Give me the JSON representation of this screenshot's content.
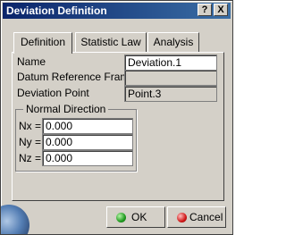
{
  "window": {
    "title": "Deviation Definition",
    "help_label": "?",
    "close_label": "X"
  },
  "tabs": [
    {
      "label": "Definition",
      "active": true
    },
    {
      "label": "Statistic Law",
      "active": false
    },
    {
      "label": "Analysis",
      "active": false
    }
  ],
  "form": {
    "name_label": "Name",
    "name_value": "Deviation.1",
    "datum_label": "Datum Reference Frame",
    "datum_value": "",
    "point_label": "Deviation Point",
    "point_value": "Point.3"
  },
  "normal_direction": {
    "title": "Normal Direction",
    "nx_label": "Nx =",
    "nx_value": "0.000",
    "ny_label": "Ny =",
    "ny_value": "0.000",
    "nz_label": "Nz =",
    "nz_value": "0.000"
  },
  "buttons": {
    "ok_label": "OK",
    "cancel_label": "Cancel"
  },
  "colors": {
    "titlebar_start": "#0a246a",
    "titlebar_end": "#3a6ea5",
    "dialog_bg": "#d4d0c8",
    "ok_icon": "#1f9a1f",
    "cancel_icon": "#d01818"
  }
}
